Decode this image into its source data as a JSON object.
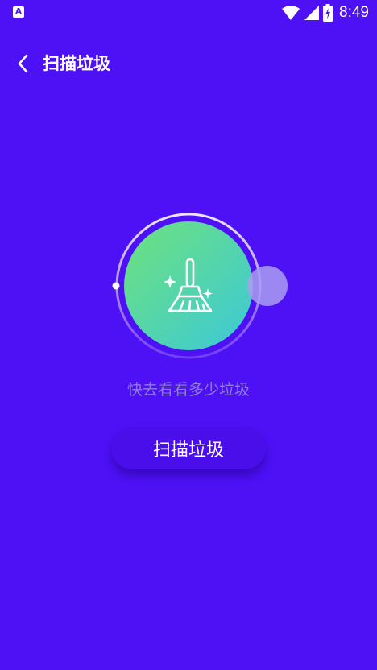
{
  "status_bar": {
    "time": "8:49",
    "app_icon": "accessibility-a-icon",
    "icons": [
      "wifi-icon",
      "signal-icon",
      "battery-charging-icon"
    ]
  },
  "header": {
    "back_icon": "back-arrow-icon",
    "title": "扫描垃圾"
  },
  "scan": {
    "icon": "broom-icon",
    "hint": "快去看看多少垃圾",
    "button_label": "扫描垃圾"
  },
  "colors": {
    "background": "#4e10f5",
    "gradient_start": "#6fe27c",
    "gradient_end": "#3bc8d9",
    "hint_text": "#8f7fd9"
  }
}
